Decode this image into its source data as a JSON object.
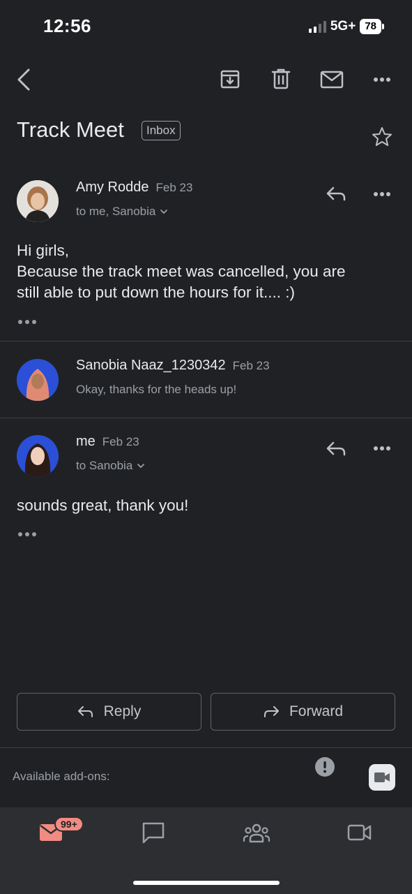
{
  "status_bar": {
    "time": "12:56",
    "network": "5G+",
    "battery": "78"
  },
  "thread": {
    "subject": "Track Meet",
    "label": "Inbox"
  },
  "messages": [
    {
      "sender": "Amy Rodde",
      "date": "Feb 23",
      "recipients": "to me, Sanobia",
      "body_lines": [
        "Hi girls,",
        "Because the track meet was cancelled, you are",
        "still able to put down the hours for it.... :)"
      ]
    },
    {
      "sender": "Sanobia Naaz_1230342",
      "date": "Feb 23",
      "snippet": "Okay, thanks for the heads up!"
    },
    {
      "sender": "me",
      "date": "Feb 23",
      "recipients": "to Sanobia",
      "body_lines": [
        "sounds great, thank you!"
      ]
    }
  ],
  "actions": {
    "reply_label": "Reply",
    "forward_label": "Forward"
  },
  "addons": {
    "label": "Available add-ons:"
  },
  "bottom_nav": {
    "mail_badge": "99+"
  },
  "colors": {
    "background": "#202124",
    "bottom_bar": "#2d2e31",
    "badge": "#f28b82",
    "text_primary": "#e8eaed",
    "text_secondary": "#9aa0a6"
  },
  "icons": [
    "back-arrow-icon",
    "archive-icon",
    "trash-icon",
    "mail-icon",
    "more-icon",
    "star-icon",
    "reply-icon",
    "forward-icon",
    "alert-icon",
    "video-icon",
    "chat-icon",
    "people-icon"
  ]
}
